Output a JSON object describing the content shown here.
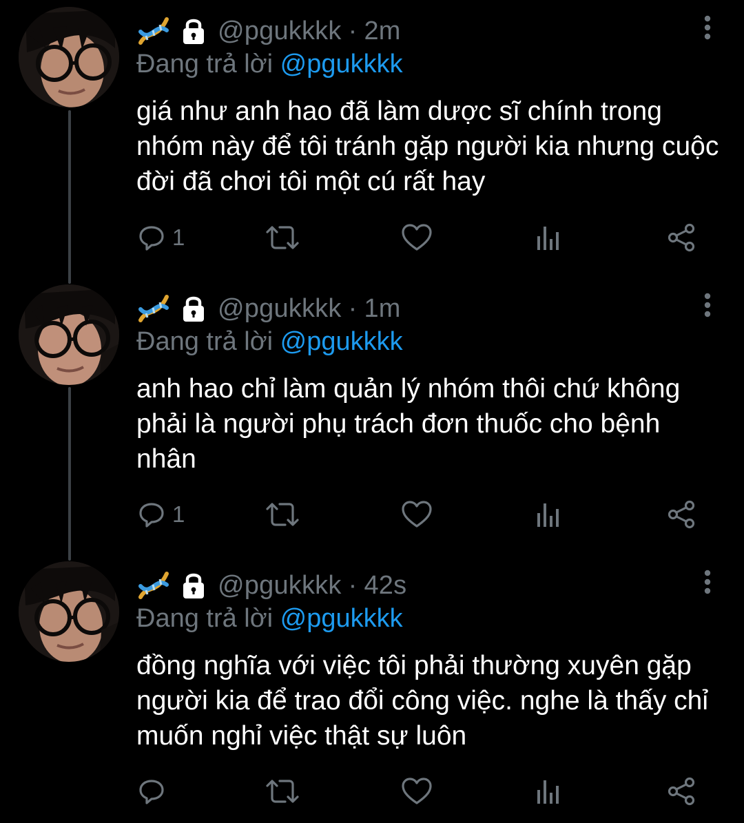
{
  "tweets": [
    {
      "handle": "@pgukkkk",
      "separator": "·",
      "time": "2m",
      "reply_prefix": "Đang trả lời",
      "reply_to": "@pgukkkk",
      "text": "giá như anh hao đã làm dược sĩ chính trong nhóm này để tôi tránh gặp người kia nhưng cuộc đời đã chơi tôi một cú rất hay",
      "reply_count": "1"
    },
    {
      "handle": "@pgukkkk",
      "separator": "·",
      "time": "1m",
      "reply_prefix": "Đang trả lời",
      "reply_to": "@pgukkkk",
      "text": "anh hao chỉ làm quản lý nhóm thôi chứ không phải là người phụ trách đơn thuốc cho bệnh nhân",
      "reply_count": "1"
    },
    {
      "handle": "@pgukkkk",
      "separator": "·",
      "time": "42s",
      "reply_prefix": "Đang trả lời",
      "reply_to": "@pgukkkk",
      "text": "đồng nghĩa với việc tôi phải thường xuyên gặp người kia để trao đổi công việc. nghe là thấy chỉ muốn nghỉ việc thật sự luôn",
      "reply_count": ""
    }
  ],
  "icons": {
    "badge": "dna-emoji-icon",
    "protected": "lock-icon",
    "more": "more-vertical-icon",
    "reply": "reply-icon",
    "retweet": "retweet-icon",
    "like": "heart-icon",
    "analytics": "analytics-icon",
    "share": "share-icon"
  },
  "colors": {
    "background": "#000000",
    "text": "#ffffff",
    "secondary_text": "#6e767d",
    "mention": "#1d9bf0",
    "thread_line": "#3c4146"
  }
}
